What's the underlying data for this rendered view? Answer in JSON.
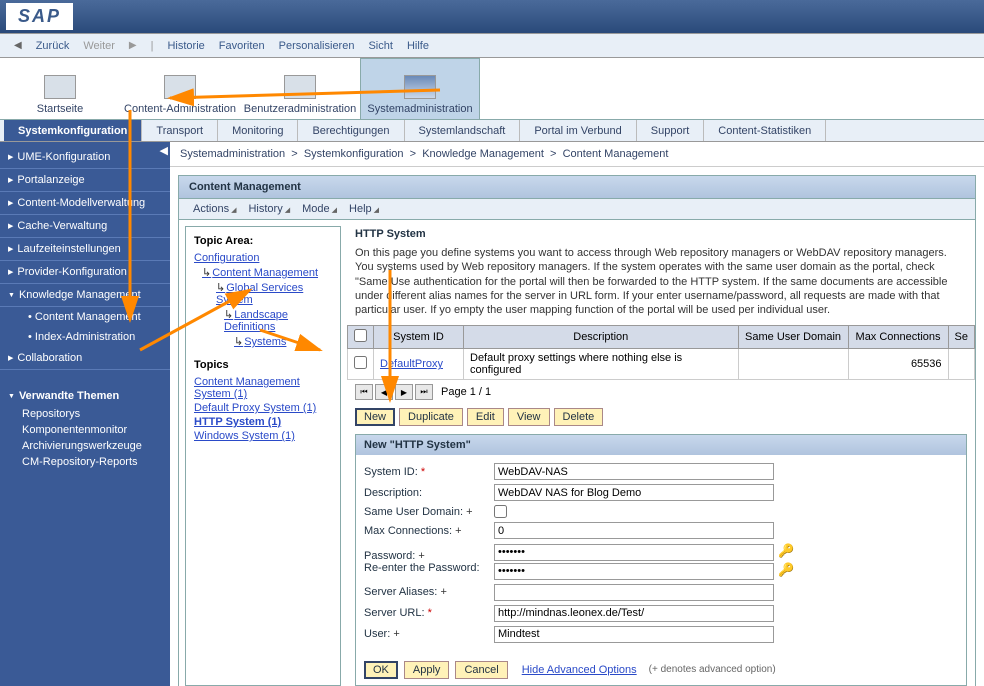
{
  "logo": "SAP",
  "topMenu": {
    "back": "Zurück",
    "forward": "Weiter",
    "history": "Historie",
    "favorites": "Favoriten",
    "personalize": "Personalisieren",
    "view": "Sicht",
    "help": "Hilfe"
  },
  "mainTabs": {
    "start": "Startseite",
    "contentAdmin": "Content-Administration",
    "userAdmin": "Benutzeradministration",
    "systemAdmin": "Systemadministration"
  },
  "subTabs": {
    "sysConfig": "Systemkonfiguration",
    "transport": "Transport",
    "monitoring": "Monitoring",
    "permissions": "Berechtigungen",
    "landscape": "Systemlandschaft",
    "federated": "Portal im Verbund",
    "support": "Support",
    "stats": "Content-Statistiken"
  },
  "leftNav": {
    "ume": "UME-Konfiguration",
    "portal": "Portalanzeige",
    "contentModel": "Content-Modellverwaltung",
    "cache": "Cache-Verwaltung",
    "runtime": "Laufzeiteinstellungen",
    "provider": "Provider-Konfiguration",
    "km": "Knowledge Management",
    "cm": "Content Management",
    "indexAdmin": "Index-Administration",
    "collab": "Collaboration",
    "relatedTitle": "Verwandte Themen",
    "repos": "Repositorys",
    "compMon": "Komponentenmonitor",
    "archTools": "Archivierungswerkzeuge",
    "cmReports": "CM-Repository-Reports"
  },
  "breadcrumb": {
    "b1": "Systemadministration",
    "b2": "Systemkonfiguration",
    "b3": "Knowledge Management",
    "b4": "Content Management",
    "sep": ">"
  },
  "panel": {
    "title": "Content Management",
    "menuActions": "Actions",
    "menuHistory": "History",
    "menuMode": "Mode",
    "menuHelp": "Help"
  },
  "topicArea": {
    "title": "Topic Area:",
    "config": "Configuration",
    "cm": "Content Management",
    "gss": "Global Services System",
    "landscape": "Landscape Definitions",
    "systems": "Systems"
  },
  "topics": {
    "title": "Topics",
    "cms": "Content Management System (1)",
    "dps": "Default Proxy System (1)",
    "http": "HTTP System (1)",
    "win": "Windows System (1)"
  },
  "httpSection": {
    "title": "HTTP System",
    "desc": "On this page you define systems you want to access through Web repository managers or WebDAV repository managers. You systems used by Web repository managers. If the system operates with the same user domain as the portal, check \"Same Use authentication for the portal will then be forwarded to the HTTP system. If the same documents are accessible under different alias names for the server in URL form. If your enter username/password, all requests are made with that particular user. If yo empty the user mapping function of the portal will be used per individual user."
  },
  "table": {
    "colSystemId": "System ID",
    "colDesc": "Description",
    "colSameUser": "Same User Domain",
    "colMaxConn": "Max Connections",
    "colSe": "Se",
    "row1SystemId": "DefaultProxy",
    "row1Desc": "Default proxy settings where nothing else is configured",
    "row1MaxConn": "65536"
  },
  "pager": "Page 1 / 1",
  "actions": {
    "new": "New",
    "duplicate": "Duplicate",
    "edit": "Edit",
    "view": "View",
    "delete": "Delete"
  },
  "form": {
    "header": "New \"HTTP System\"",
    "systemIdLabel": "System ID:",
    "systemIdVal": "WebDAV-NAS",
    "descLabel": "Description:",
    "descVal": "WebDAV NAS for Blog Demo",
    "sameUserLabel": "Same User Domain:",
    "maxConnLabel": "Max Connections:",
    "maxConnVal": "0",
    "pwdLabel": "Password:",
    "pwdRepeatLabel": "Re-enter the Password:",
    "pwdVal": "•••••••",
    "aliasLabel": "Server Aliases:",
    "aliasVal": "",
    "urlLabel": "Server URL:",
    "urlVal": "http://mindnas.leonex.de/Test/",
    "userLabel": "User:",
    "userVal": "Mindtest",
    "ok": "OK",
    "apply": "Apply",
    "cancel": "Cancel",
    "advanced": "Hide Advanced Options",
    "note": "(+ denotes advanced option)"
  }
}
